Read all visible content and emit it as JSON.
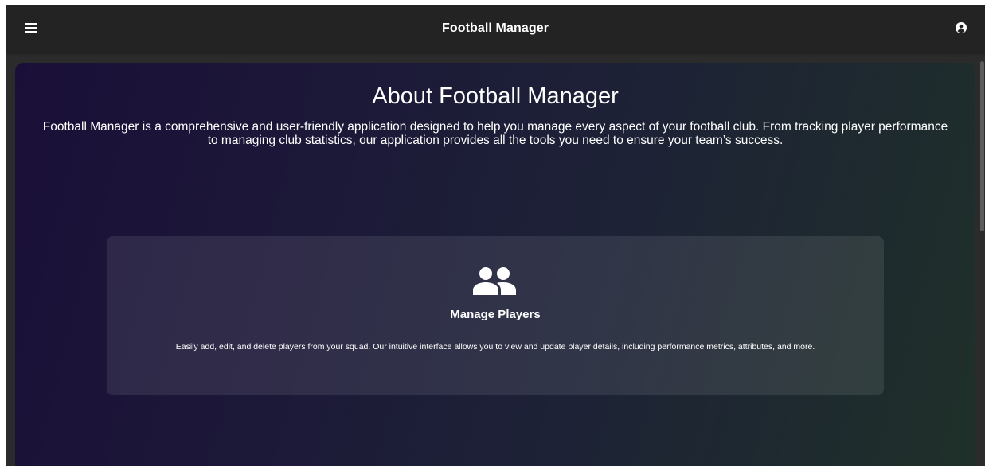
{
  "appbar": {
    "title": "Football Manager",
    "menu_icon": "menu-icon",
    "account_icon": "account-circle-icon"
  },
  "about": {
    "heading": "About Football Manager",
    "intro": "Football Manager is a comprehensive and user-friendly application designed to help you manage every aspect of your football club. From tracking player performance to managing club statistics, our application provides all the tools you need to ensure your team’s success."
  },
  "features": [
    {
      "icon": "people-icon",
      "title": "Manage Players",
      "description": "Easily add, edit, and delete players from your squad. Our intuitive interface allows you to view and update player details, including performance metrics, attributes, and more."
    }
  ],
  "colors": {
    "appbar_bg": "#232323",
    "page_bg": "#2b2b2b",
    "gradient_start": "#1a0f38",
    "gradient_end": "#1f3029",
    "text": "#ffffff"
  }
}
